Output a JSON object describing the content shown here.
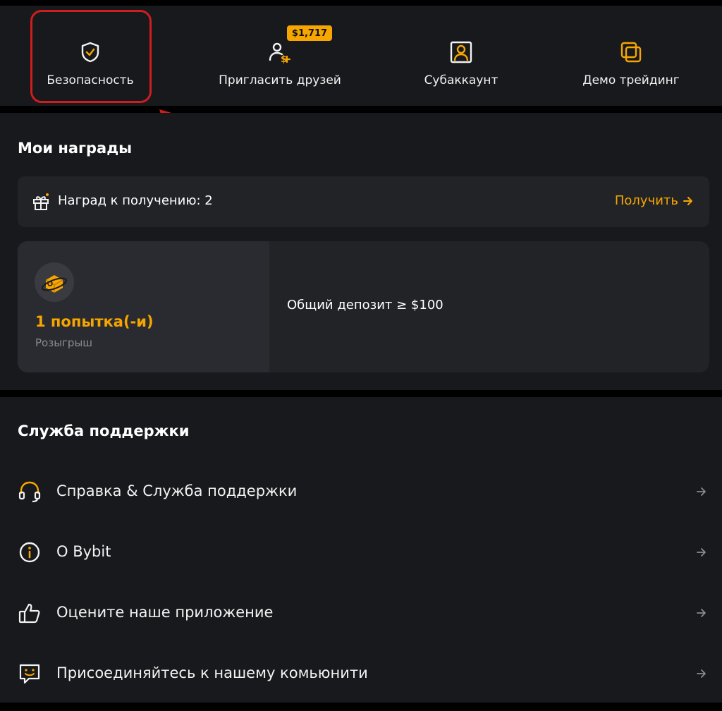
{
  "quick_actions": [
    {
      "label": "Безопасность",
      "icon": "shield-check-icon"
    },
    {
      "label": "Пригласить друзей",
      "icon": "invite-friends-icon",
      "badge": "$1,717"
    },
    {
      "label": "Субаккаунт",
      "icon": "subaccount-icon"
    },
    {
      "label": "Демо трейдинг",
      "icon": "demo-trading-icon"
    }
  ],
  "rewards": {
    "title": "Мои награды",
    "claimable_text": "Наград к получению: 2",
    "claim_button": "Получить",
    "lottery": {
      "count": "1 попытка(-и)",
      "label": "Розыгрыш",
      "condition": "Общий депозит ≥ $100"
    }
  },
  "support": {
    "title": "Служба поддержки",
    "items": [
      {
        "label": "Справка & Служба поддержки",
        "icon": "headset-icon"
      },
      {
        "label": "О Bybit",
        "icon": "info-icon"
      },
      {
        "label": "Оцените наше приложение",
        "icon": "thumbs-up-icon"
      },
      {
        "label": "Присоединяйтесь к нашему комьюнити",
        "icon": "chat-smile-icon"
      }
    ]
  },
  "colors": {
    "accent": "#f7a600",
    "panel": "#18191c",
    "card": "#222327",
    "highlight": "#d01d1d"
  }
}
